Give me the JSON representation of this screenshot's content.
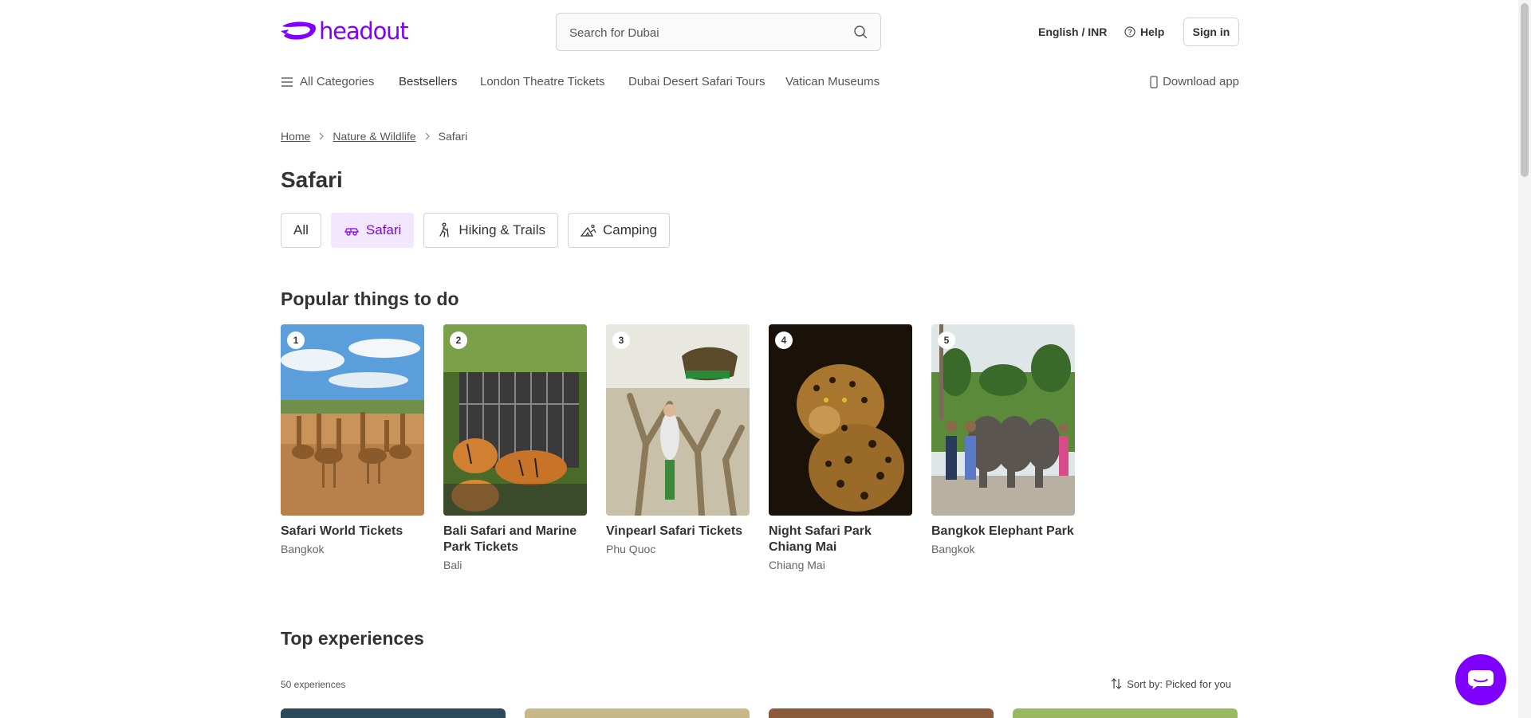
{
  "header": {
    "logo_text": "headout",
    "search_placeholder": "Search for Dubai",
    "language": "English / INR",
    "help": "Help",
    "sign_in": "Sign in"
  },
  "nav": {
    "all_categories": "All Categories",
    "items": [
      "Bestsellers",
      "London Theatre Tickets",
      "Dubai Desert Safari Tours",
      "Vatican Museums"
    ],
    "download_app": "Download app"
  },
  "breadcrumb": {
    "home": "Home",
    "category": "Nature & Wildlife",
    "current": "Safari"
  },
  "page_title": "Safari",
  "chips": [
    {
      "label": "All",
      "icon": "none",
      "active": false
    },
    {
      "label": "Safari",
      "icon": "safari-car-icon",
      "active": true
    },
    {
      "label": "Hiking & Trails",
      "icon": "hiking-icon",
      "active": false
    },
    {
      "label": "Camping",
      "icon": "camping-icon",
      "active": false
    }
  ],
  "popular": {
    "title": "Popular things to do",
    "items": [
      {
        "rank": "1",
        "title": "Safari World Tickets",
        "city": "Bangkok"
      },
      {
        "rank": "2",
        "title": "Bali Safari and Marine Park Tickets",
        "city": "Bali"
      },
      {
        "rank": "3",
        "title": "Vinpearl Safari Tickets",
        "city": "Phu Quoc"
      },
      {
        "rank": "4",
        "title": "Night Safari Park Chiang Mai",
        "city": "Chiang Mai"
      },
      {
        "rank": "5",
        "title": "Bangkok Elephant Park",
        "city": "Bangkok"
      }
    ]
  },
  "top_experiences": {
    "title": "Top experiences",
    "count": "50 experiences",
    "sort": "Sort by: Picked for you"
  },
  "colors": {
    "brand": "#8000ff",
    "chip_active_bg": "#f3e7ff"
  }
}
